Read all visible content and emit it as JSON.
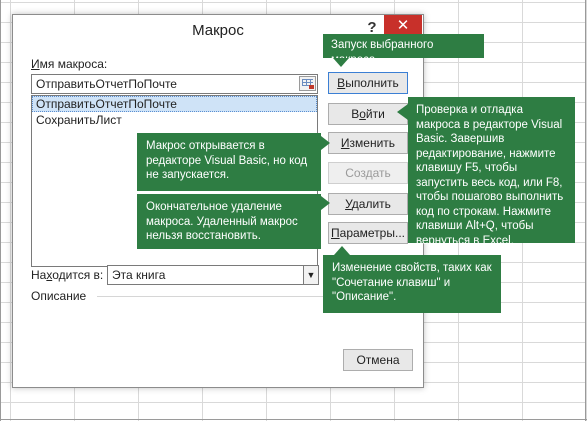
{
  "dialog": {
    "title": "Макрос",
    "help_glyph": "?",
    "close_glyph": "✕",
    "macro_name_label_prefix": "",
    "macro_name_label_u": "И",
    "macro_name_label_rest": "мя макроса:",
    "macro_name_value": "ОтправитьОтчетПоПочте",
    "macros": [
      "ОтправитьОтчетПоПочте",
      "СохранитьЛист"
    ],
    "location_label_prefix": "На",
    "location_label_u": "х",
    "location_label_rest": "одится в:",
    "location_value": "Эта книга",
    "description_label": "Описание"
  },
  "buttons": {
    "run_u": "В",
    "run_rest": "ыполнить",
    "step_pre": "В",
    "step_u": "о",
    "step_rest": "йти",
    "edit_pre": "",
    "edit_u": "И",
    "edit_rest": "зменить",
    "create": "Создать",
    "delete_u": "У",
    "delete_rest": "далить",
    "options_u": "П",
    "options_rest": "араметры...",
    "cancel": "Отмена"
  },
  "callouts": {
    "run": "Запуск выбранного макроса.",
    "step": "Проверка и отладка макроса в редакторе Visual Basic. Завершив редактирование, нажмите клавишу F5, чтобы запустить весь код, или F8, чтобы пошагово выполнить код по строкам. Нажмите клавиши Alt+Q, чтобы вернуться в Excel.",
    "edit": "Макрос открывается в редакторе Visual Basic, но код не запускается.",
    "delete": "Окончательное удаление макроса. Удаленный макрос нельзя восстановить.",
    "options": "Изменение свойств, таких как \"Сочетание клавиш\" и \"Описание\"."
  },
  "colors": {
    "callout_green": "#2e7d43",
    "close_red": "#c8302a",
    "selection_blue": "#cfe3f7"
  },
  "icons": {
    "ref_edit": "collapse-dialog-icon",
    "dropdown": "chevron-down-icon"
  }
}
